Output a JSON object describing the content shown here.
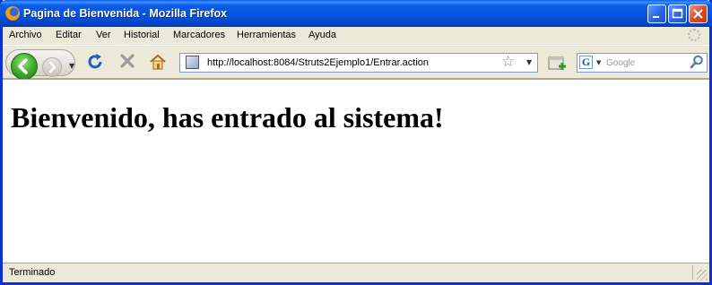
{
  "window": {
    "title": "Pagina de Bienvenida - Mozilla Firefox",
    "minimize": "_",
    "maximize": "□",
    "close": "✕"
  },
  "menu": {
    "items": [
      "Archivo",
      "Editar",
      "Ver",
      "Historial",
      "Marcadores",
      "Herramientas",
      "Ayuda"
    ]
  },
  "toolbar": {
    "url": "http://localhost:8084/Struts2Ejemplo1/Entrar.action",
    "search_placeholder": "Google",
    "icons": {
      "back": "back-arrow-icon",
      "forward": "forward-arrow-icon",
      "reload": "reload-icon",
      "stop": "stop-icon",
      "home": "home-icon",
      "bookmark": "star-icon",
      "new_tab": "new-tab-icon",
      "search_engine": "google-icon",
      "search": "magnifier-icon"
    }
  },
  "page": {
    "heading": "Bienvenido, has entrado al sistema!"
  },
  "statusbar": {
    "text": "Terminado"
  },
  "colors": {
    "titlebar": "#0453dd",
    "chrome": "#ece9d8",
    "content": "#ffffff"
  }
}
